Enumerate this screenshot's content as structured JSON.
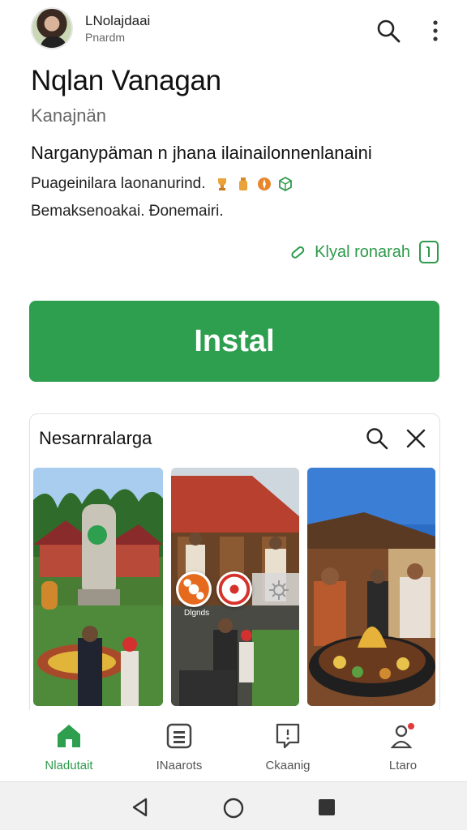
{
  "developer": {
    "name": "LNolajdaai",
    "subtitle": "Pnardm"
  },
  "app": {
    "title": "Nqlan Vanagan",
    "subtitle": "Kanajnän",
    "tagline": "Narganypäman n jhana ilainailonnenlanaini",
    "desc_line1": "Puageinilara laonanurind.",
    "desc_line2": "Bemaksenoakai. Đonemairi.",
    "link_text": "Klyal ronarah"
  },
  "install": {
    "label": "Instal"
  },
  "card": {
    "title": "Nesarnralarga",
    "overlay_label": "Dlgnds"
  },
  "bottom_nav": [
    {
      "label": "Nladutait",
      "icon": "home-icon",
      "active": true
    },
    {
      "label": "INaarots",
      "icon": "apps-icon",
      "active": false
    },
    {
      "label": "Ckaanig",
      "icon": "chat-icon",
      "active": false
    },
    {
      "label": "Ltaro",
      "icon": "profile-icon",
      "active": false
    }
  ],
  "colors": {
    "accent": "#2e9e4f",
    "accent_text": "#2e9a4b"
  }
}
